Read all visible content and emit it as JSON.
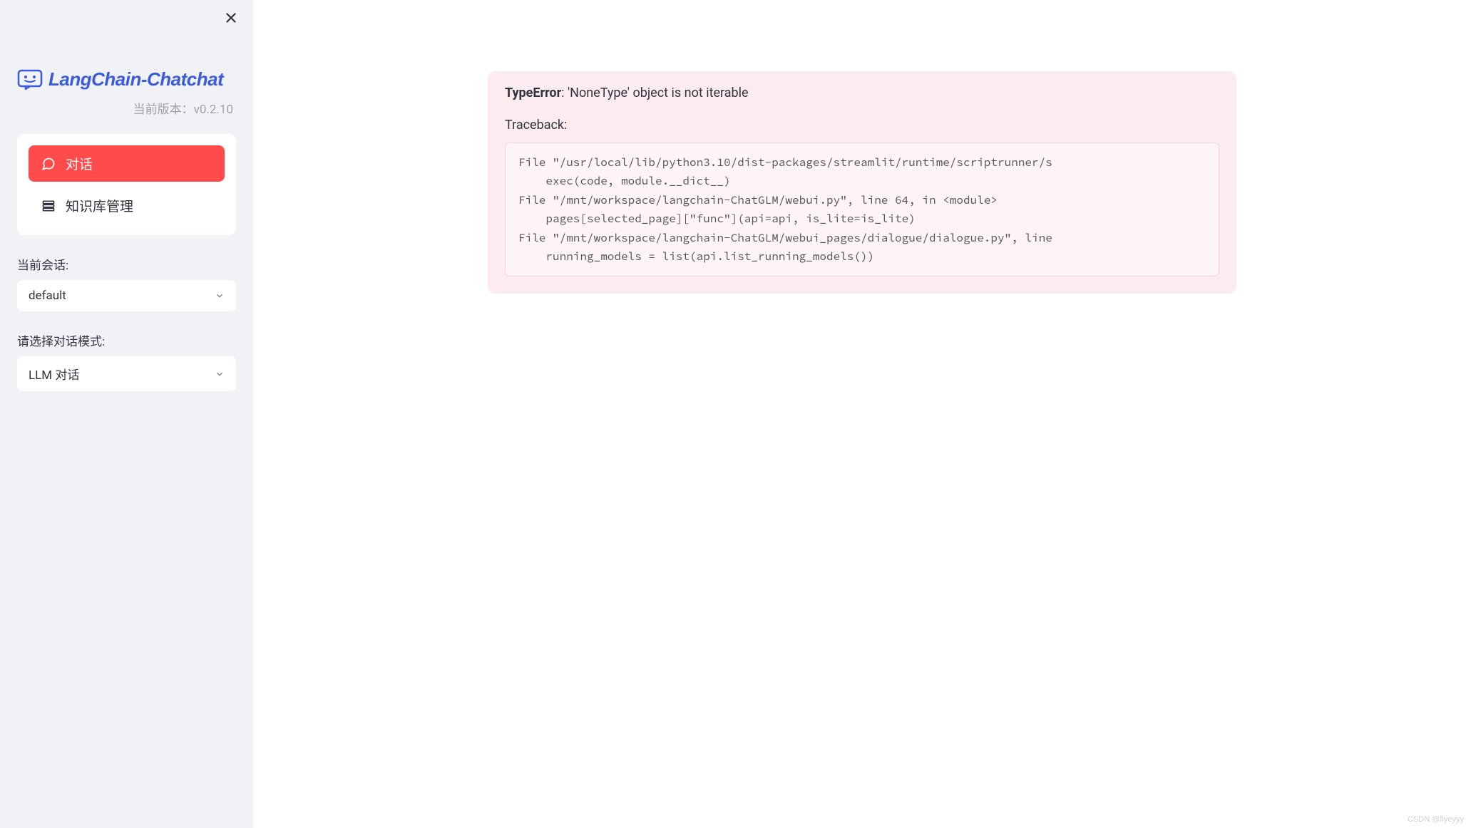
{
  "sidebar": {
    "logo_text": "LangChain-Chatchat",
    "version_label": "当前版本：",
    "version": "v0.2.10",
    "nav": {
      "chat_label": "对话",
      "kb_label": "知识库管理"
    },
    "session_label": "当前会话:",
    "session_value": "default",
    "mode_label": "请选择对话模式:",
    "mode_value": "LLM 对话"
  },
  "error": {
    "type": "TypeError",
    "message": ": 'NoneType' object is not iterable",
    "traceback_label": "Traceback:",
    "traceback": "File \"/usr/local/lib/python3.10/dist-packages/streamlit/runtime/scriptrunner/s\n    exec(code, module.__dict__)\nFile \"/mnt/workspace/langchain-ChatGLM/webui.py\", line 64, in <module>\n    pages[selected_page][\"func\"](api=api, is_lite=is_lite)\nFile \"/mnt/workspace/langchain-ChatGLM/webui_pages/dialogue/dialogue.py\", line\n    running_models = list(api.list_running_models())"
  },
  "watermark": "CSDN @flyeyyy"
}
